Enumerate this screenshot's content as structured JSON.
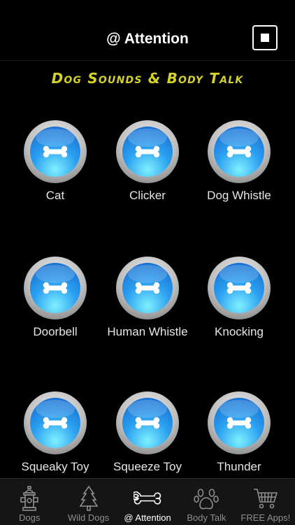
{
  "header": {
    "title": "@ Attention",
    "stop_icon": "stop-icon"
  },
  "banner": {
    "text": "Dog Sounds & Body Talk",
    "color": "#d4d12a"
  },
  "sounds": [
    {
      "label": "Cat",
      "icon": "bone-icon"
    },
    {
      "label": "Clicker",
      "icon": "bone-icon"
    },
    {
      "label": "Dog Whistle",
      "icon": "bone-icon"
    },
    {
      "label": "Doorbell",
      "icon": "bone-icon"
    },
    {
      "label": "Human Whistle",
      "icon": "bone-icon"
    },
    {
      "label": "Knocking",
      "icon": "bone-icon"
    },
    {
      "label": "Squeaky Toy",
      "icon": "bone-icon"
    },
    {
      "label": "Squeeze Toy",
      "icon": "bone-icon"
    },
    {
      "label": "Thunder",
      "icon": "bone-icon"
    }
  ],
  "tabbar": {
    "items": [
      {
        "label": "Dogs",
        "icon": "fire-hydrant-icon",
        "active": false
      },
      {
        "label": "Wild Dogs",
        "icon": "pine-tree-icon",
        "active": false
      },
      {
        "label": "@ Attention",
        "icon": "bone-icon",
        "active": true
      },
      {
        "label": "Body Talk",
        "icon": "paw-print-icon",
        "active": false
      },
      {
        "label": "FREE Apps!",
        "icon": "shopping-cart-icon",
        "active": false
      }
    ]
  },
  "colors": {
    "background": "#000000",
    "button_blue": "#2a9ff0",
    "tab_active": "#ffffff",
    "tab_inactive": "#8e8e8e"
  }
}
